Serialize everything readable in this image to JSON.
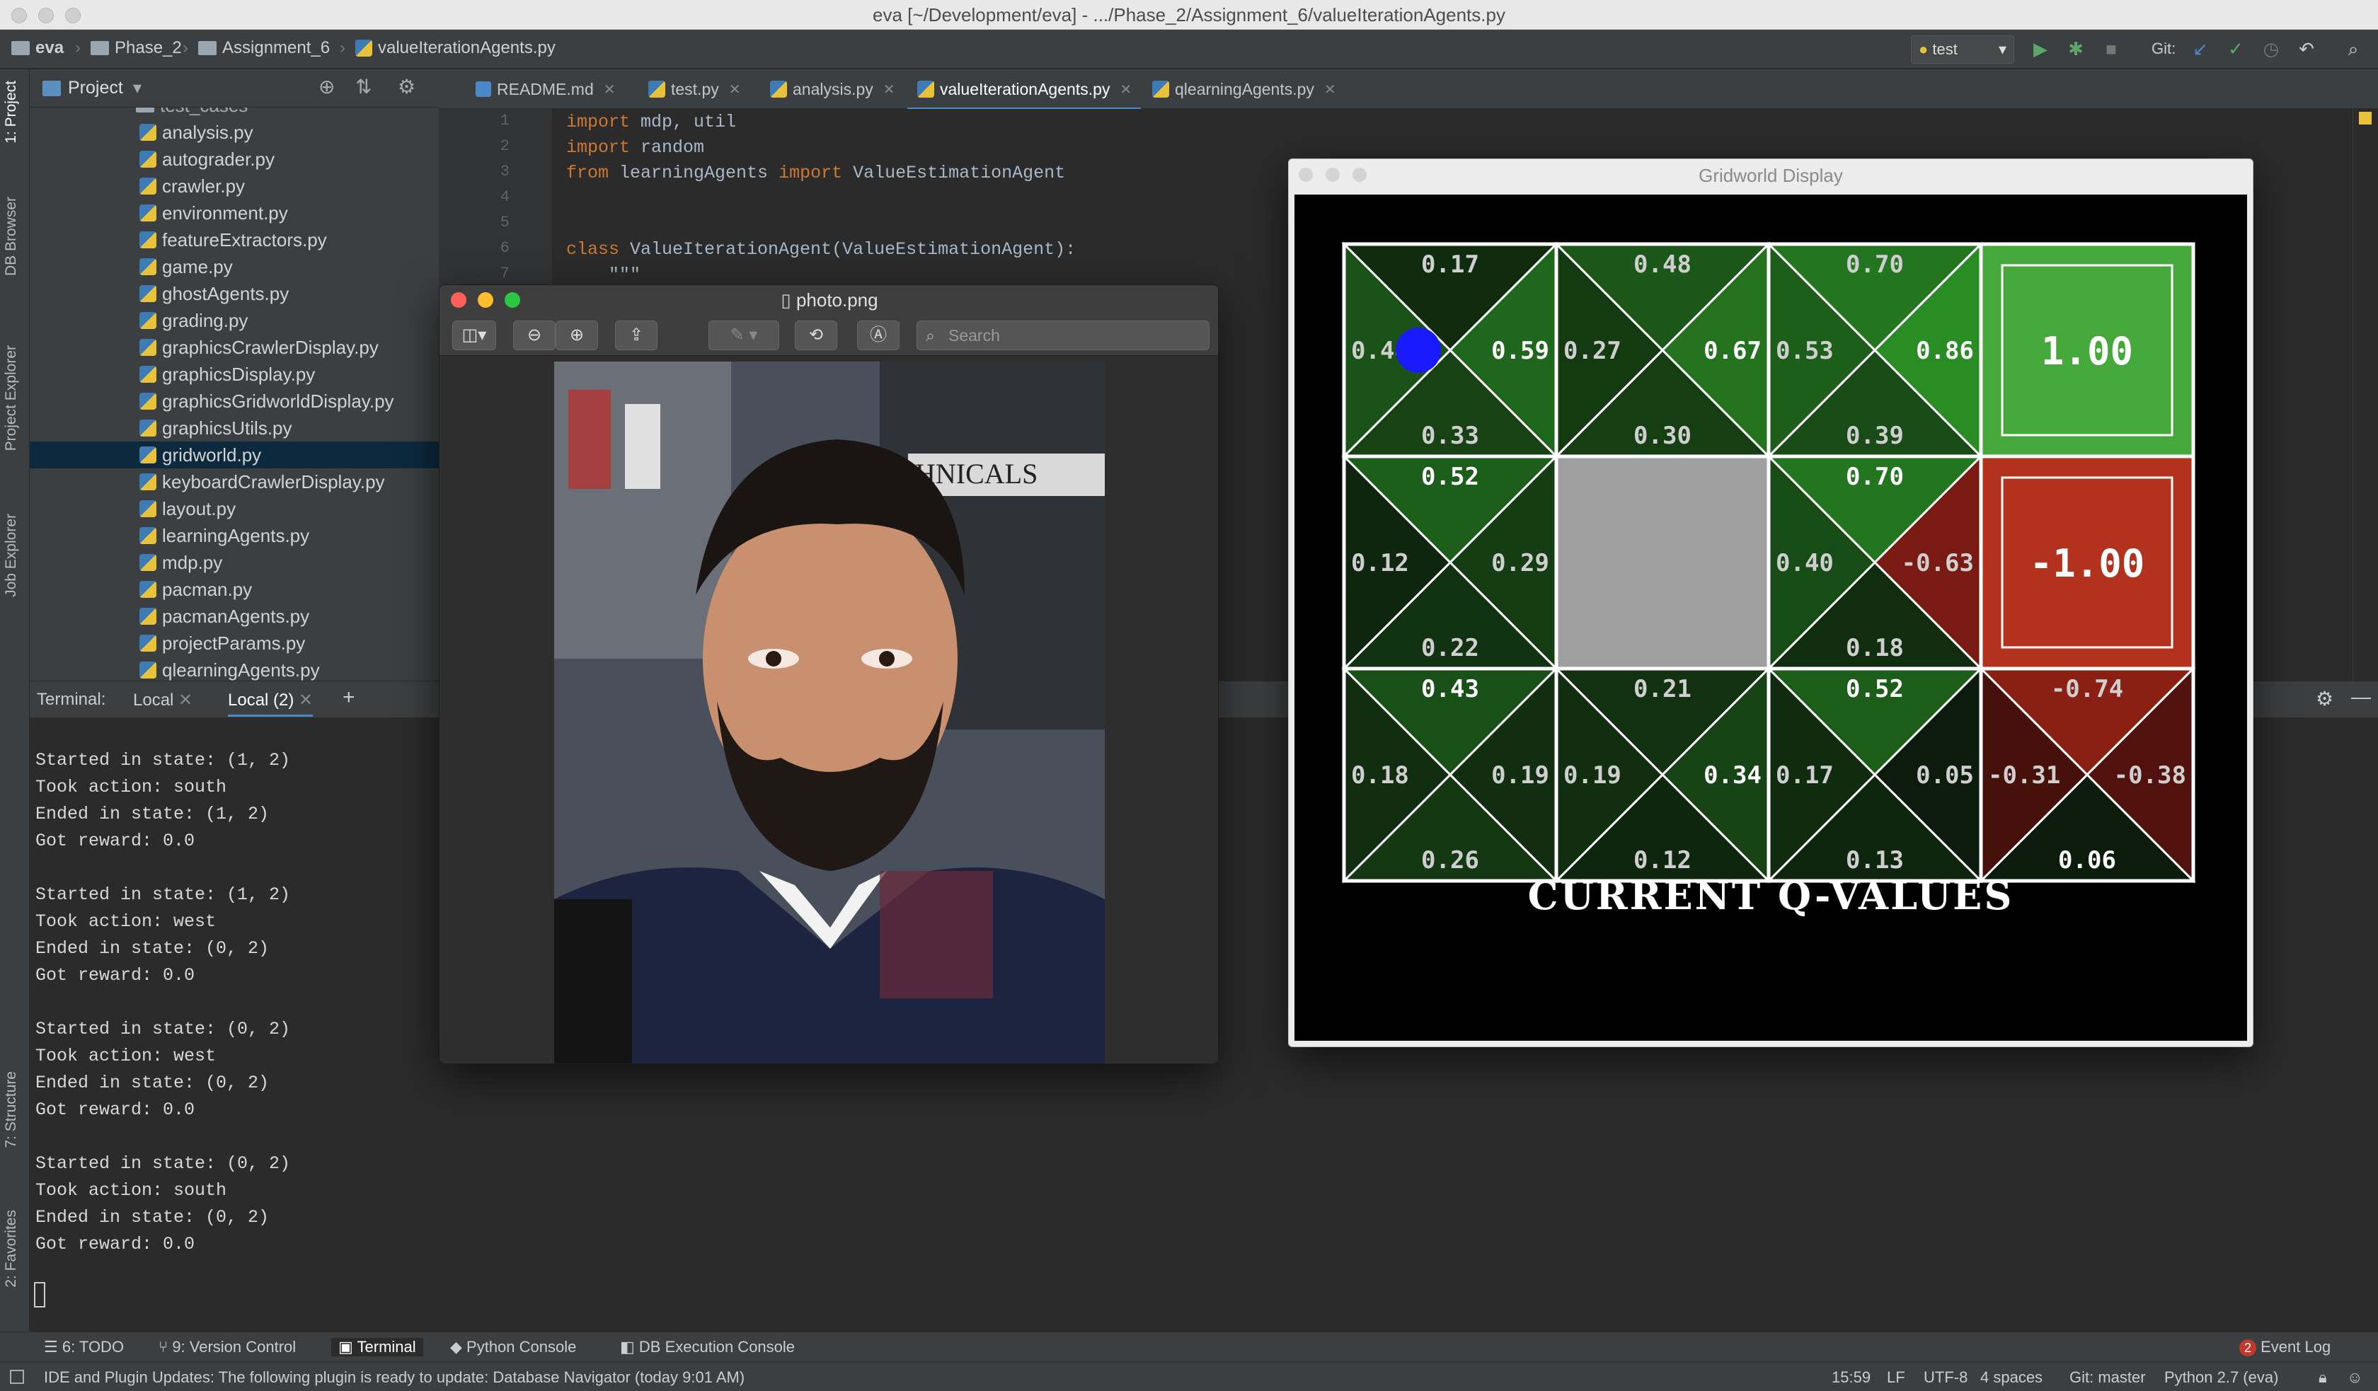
{
  "window": {
    "title": "eva [~/Development/eva] - .../Phase_2/Assignment_6/valueIterationAgents.py"
  },
  "navbar": {
    "breadcrumb": [
      "eva",
      "Phase_2",
      "Assignment_6",
      "valueIterationAgents.py"
    ],
    "run_config": "test",
    "git_label": "Git:"
  },
  "left_tools": [
    "1: Project",
    "DB Browser",
    "Project Explorer",
    "Job Explorer",
    "7: Structure",
    "2: Favorites"
  ],
  "project": {
    "header": "Project",
    "partial_top": "test_cases",
    "files": [
      "analysis.py",
      "autograder.py",
      "crawler.py",
      "environment.py",
      "featureExtractors.py",
      "game.py",
      "ghostAgents.py",
      "grading.py",
      "graphicsCrawlerDisplay.py",
      "graphicsDisplay.py",
      "graphicsGridworldDisplay.py",
      "graphicsUtils.py",
      "gridworld.py",
      "keyboardCrawlerDisplay.py",
      "layout.py",
      "learningAgents.py",
      "mdp.py",
      "pacman.py",
      "pacmanAgents.py",
      "projectParams.py",
      "qlearningAgents.py"
    ],
    "selected": "gridworld.py"
  },
  "editor": {
    "tabs": [
      "README.md",
      "test.py",
      "analysis.py",
      "valueIterationAgents.py",
      "qlearningAgents.py"
    ],
    "active_tab": "valueIterationAgents.py",
    "line_numbers": [
      "1",
      "2",
      "3",
      "4",
      "5",
      "6",
      "7"
    ],
    "lines": [
      {
        "kw": "import",
        "rest": " mdp, util"
      },
      {
        "kw": "import",
        "rest": " random"
      },
      {
        "kw": "from",
        "rest": " learningAgents ",
        "kw2": "import",
        "rest2": " ValueEstimationAgent"
      },
      {
        "kw": "",
        "rest": ""
      },
      {
        "kw": "",
        "rest": ""
      },
      {
        "kw": "class",
        "rest": " ValueIterationAgent(ValueEstimationAgent):"
      },
      {
        "kw": "",
        "rest": "    \"\"\""
      }
    ]
  },
  "terminal": {
    "label": "Terminal:",
    "tabs": [
      "Local",
      "Local (2)"
    ],
    "lines": [
      "Started in state: (1, 2)",
      "Took action: south",
      "Ended in state: (1, 2)",
      "Got reward: 0.0",
      "",
      "Started in state: (1, 2)",
      "Took action: west",
      "Ended in state: (0, 2)",
      "Got reward: 0.0",
      "",
      "Started in state: (0, 2)",
      "Took action: west",
      "Ended in state: (0, 2)",
      "Got reward: 0.0",
      "",
      "Started in state: (0, 2)",
      "Took action: south",
      "Ended in state: (0, 2)",
      "Got reward: 0.0"
    ]
  },
  "bottom_tools": [
    "6: TODO",
    "9: Version Control",
    "Terminal",
    "Python Console",
    "DB Execution Console"
  ],
  "event_log": {
    "label": "Event Log",
    "count": "2"
  },
  "status": {
    "message": "IDE and Plugin Updates: The following plugin is ready to update: Database Navigator (today 9:01 AM)",
    "position": "15:59",
    "line_sep": "LF",
    "encoding": "UTF-8",
    "indent": "4 spaces",
    "branch": "Git: master",
    "interpreter": "Python 2.7 (eva)"
  },
  "preview": {
    "title": "photo.png",
    "search_placeholder": "Search",
    "photo_sign": "HNICALS"
  },
  "gridworld": {
    "window_title": "Gridworld Display",
    "caption": "CURRENT Q-VALUES",
    "colors": {
      "positive": "#2e7d1e",
      "negative": "#a12a1a",
      "wall": "#a0a0a0",
      "agent": "#1a1aff"
    },
    "rows": [
      [
        {
          "type": "q",
          "n": "0.17",
          "e": "0.59",
          "s": "0.33",
          "w": "0.44"
        },
        {
          "type": "q",
          "n": "0.48",
          "e": "0.67",
          "s": "0.30",
          "w": "0.27"
        },
        {
          "type": "q",
          "n": "0.70",
          "e": "0.86",
          "s": "0.39",
          "w": "0.53"
        },
        {
          "type": "terminal",
          "value": "1.00"
        }
      ],
      [
        {
          "type": "q",
          "n": "0.52",
          "e": "0.29",
          "s": "0.22",
          "w": "0.12"
        },
        {
          "type": "wall"
        },
        {
          "type": "q",
          "n": "0.70",
          "e": "-0.63",
          "s": "0.18",
          "w": "0.40"
        },
        {
          "type": "terminal",
          "value": "-1.00"
        }
      ],
      [
        {
          "type": "q",
          "n": "0.43",
          "e": "0.19",
          "s": "0.26",
          "w": "0.18"
        },
        {
          "type": "q",
          "n": "0.21",
          "e": "0.34",
          "s": "0.12",
          "w": "0.19"
        },
        {
          "type": "q",
          "n": "0.52",
          "e": "0.05",
          "s": "0.13",
          "w": "0.17"
        },
        {
          "type": "q",
          "n": "-0.74",
          "e": "-0.38",
          "s": "0.06",
          "w": "-0.31"
        }
      ]
    ],
    "agent_cell": {
      "row": 0,
      "col": 0
    }
  }
}
